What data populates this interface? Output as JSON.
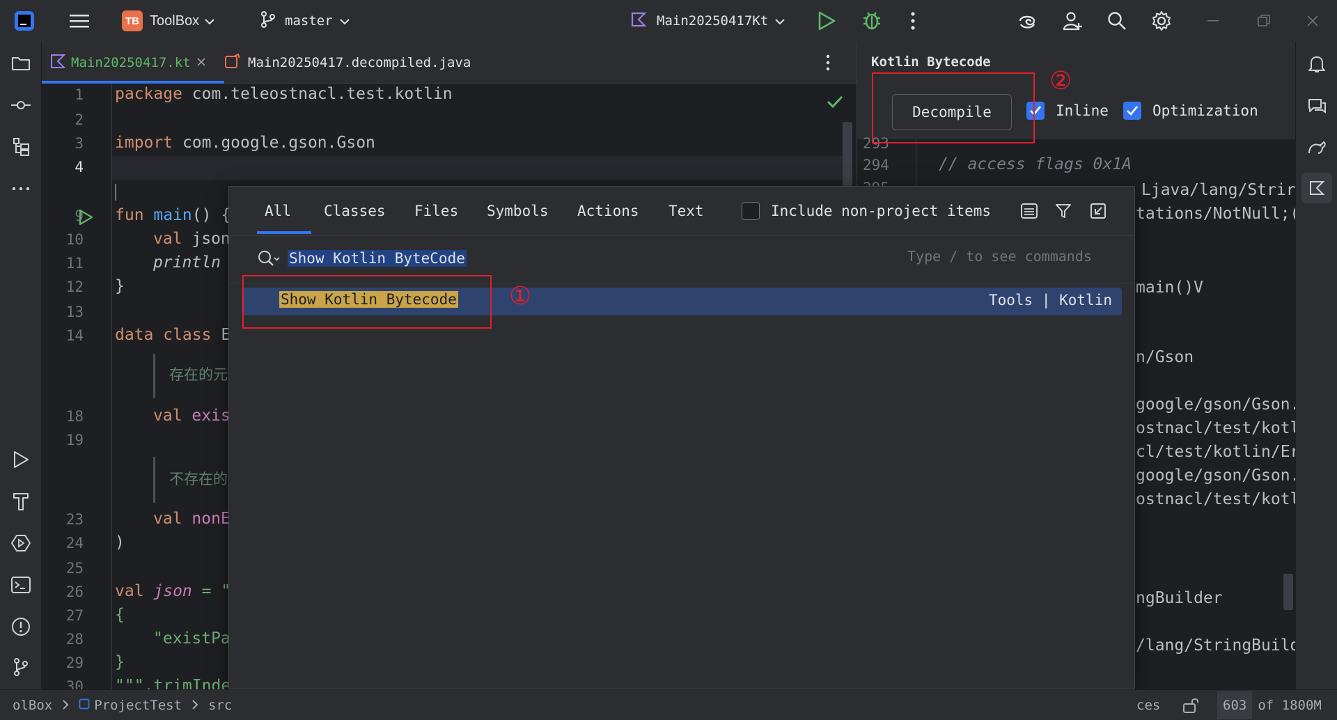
{
  "titlebar": {
    "project_badge": "TB",
    "project_name": "ToolBox",
    "branch": "master",
    "run_config": "Main20250417Kt"
  },
  "tabs": [
    {
      "label": "Main20250417.kt"
    },
    {
      "label": "Main20250417.decompiled.java"
    }
  ],
  "editor": {
    "lines": [
      {
        "n": "1"
      },
      {
        "n": "2"
      },
      {
        "n": "3"
      },
      {
        "n": "4"
      },
      {
        "n": "9"
      },
      {
        "n": "10"
      },
      {
        "n": "11"
      },
      {
        "n": "12"
      },
      {
        "n": "13"
      },
      {
        "n": "14"
      },
      {
        "n": "18"
      },
      {
        "n": "19"
      },
      {
        "n": "23"
      },
      {
        "n": "24"
      },
      {
        "n": "25"
      },
      {
        "n": "26"
      },
      {
        "n": "27"
      },
      {
        "n": "28"
      },
      {
        "n": "29"
      },
      {
        "n": "30"
      }
    ],
    "code": {
      "l1_kw": "package",
      "l1_rest": " com.teleostnacl.test.kotlin",
      "l3_kw": "import",
      "l3_rest": " com.google.gson.Gson",
      "l9_kw": "fun",
      "l9_fn": " main",
      "l9_rest": "() {",
      "l10_kw": "val",
      "l10_rest": " json",
      "l11_fn": "println",
      "l12": "}",
      "l14_kw": "data class",
      "l14_rest": " E",
      "doc1": "存在的元",
      "l18_kw": "val",
      "l18_rest": " exis",
      "doc2": "不存在的",
      "l23_kw": "val",
      "l23_rest": " nonE",
      "l24": ")",
      "l26_kw": "val",
      "l26_var": " json",
      "l26_rest": " = \"",
      "l27": "{",
      "l28": "\"existPa",
      "l29": "}",
      "l30": "\"\"\".trimInde"
    }
  },
  "bytecode": {
    "title": "Kotlin Bytecode",
    "decompile": "Decompile",
    "inline": "Inline",
    "optimization": "Optimization",
    "line_numbers": [
      "293",
      "294",
      "295"
    ],
    "comment": "// access flags 0x1A",
    "fragments": [
      "Ljava/lang/Strir",
      "tations/NotNull;(",
      "main()V",
      "n/Gson",
      "google/gson/Gson.",
      "ostnacl/test/kotl",
      "cl/test/kotlin/Er",
      "google/gson/Gson.",
      "ostnacl/test/kotl",
      "ngBuilder",
      "/lang/StringBuild"
    ]
  },
  "popup": {
    "tabs": [
      "All",
      "Classes",
      "Files",
      "Symbols",
      "Actions",
      "Text"
    ],
    "include_label": "Include non-project items",
    "query": "Show Kotlin ByteCode",
    "hint": "Type / to see commands",
    "result_label": "Show Kotlin Bytecode",
    "result_path": "Tools | Kotlin"
  },
  "annotations": {
    "one": "①",
    "two": "②"
  },
  "statusbar": {
    "crumb1": "olBox",
    "crumb2": "ProjectTest",
    "crumb3": "src",
    "right_fragment": "ces",
    "memory_used": "603",
    "memory_total": "of 1800M"
  },
  "colors": {
    "accent": "#3574f0",
    "highlight_match": "#c9a449",
    "selection_row": "#2e436e",
    "annotation_red": "#e0202a"
  }
}
